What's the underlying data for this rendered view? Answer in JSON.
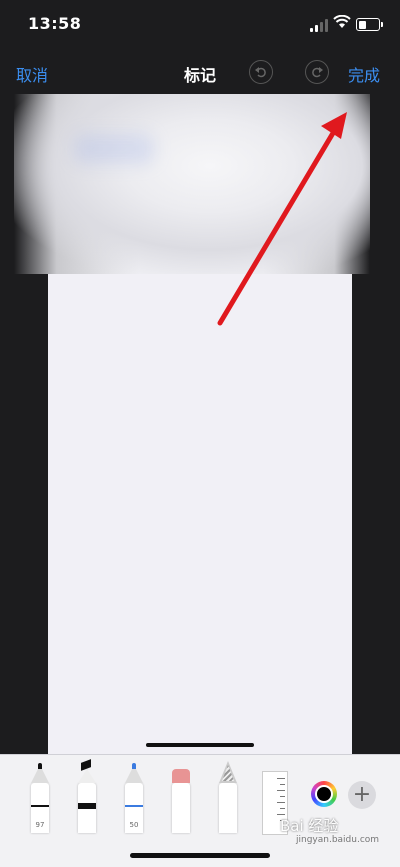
{
  "status_bar": {
    "time": "13:58"
  },
  "nav": {
    "cancel_label": "取消",
    "title": "标记",
    "done_label": "完成"
  },
  "tools": [
    {
      "name": "pen",
      "value": "97"
    },
    {
      "name": "marker",
      "value": ""
    },
    {
      "name": "pencil",
      "value": "50"
    },
    {
      "name": "eraser",
      "value": ""
    },
    {
      "name": "lasso",
      "value": ""
    },
    {
      "name": "ruler",
      "value": ""
    }
  ],
  "toolbar": {
    "add_label": "+",
    "watermark": "Bai 经验",
    "watermark_url": "jingyan.baidu.com"
  },
  "colors": {
    "accent": "#3b8ef0",
    "annotation_arrow": "#e0191e",
    "selected_color": "#000000"
  }
}
